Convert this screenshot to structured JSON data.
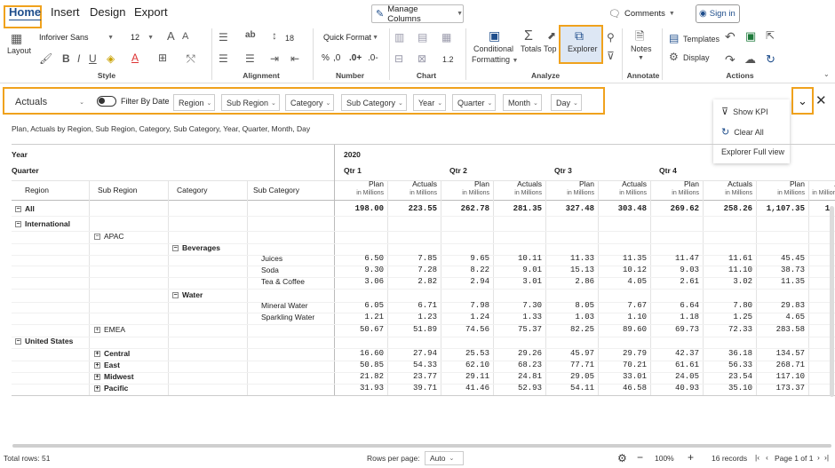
{
  "ribbon": {
    "tabs": [
      "Home",
      "Insert",
      "Design",
      "Export"
    ],
    "manage_columns": "Manage Columns",
    "comments": "Comments",
    "sign_in": "Sign in",
    "font_name": "Inforiver Sans",
    "font_size": "12",
    "row_height": "18",
    "number_format": "Quick Format",
    "layout_label": "Layout",
    "cond_format_l1": "Conditional",
    "cond_format_l2": "Formatting",
    "totals": "Totals",
    "top_n": "Top n",
    "explorer": "Explorer",
    "notes": "Notes",
    "templates": "Templates",
    "display": "Display",
    "groups": {
      "style": "Style",
      "alignment": "Alignment",
      "number": "Number",
      "chart": "Chart",
      "analyze": "Analyze",
      "annotate": "Annotate",
      "actions": "Actions"
    },
    "decimal_small": "1.2",
    "pct": "%",
    "comma": ",0",
    "dec_plus": ".0+",
    "dec_minus": ".0-"
  },
  "filter_bar": {
    "scenario": "Actuals",
    "filter_by_date": "Filter By Date",
    "chips": [
      "Region",
      "Sub Region",
      "Category",
      "Sub Category",
      "Year",
      "Quarter",
      "Month",
      "Day"
    ]
  },
  "menu": {
    "show_kpi": "Show KPI",
    "clear_all": "Clear All",
    "explorer_full_view": "Explorer Full view"
  },
  "grid": {
    "title": "Plan, Actuals by Region, Sub Region, Category, Sub Category, Year, Quarter, Month, Day",
    "year_label": "Year",
    "quarter_label": "Quarter",
    "year": "2020",
    "quarters": [
      "Qtr 1",
      "Qtr 2",
      "Qtr 3",
      "Qtr 4"
    ],
    "dim_headers": [
      "Region",
      "Sub Region",
      "Category",
      "Sub Category"
    ],
    "measure_names": [
      "Plan",
      "Actuals",
      "Plan",
      "Actuals",
      "Plan",
      "Actuals",
      "Plan",
      "Actuals",
      "Plan",
      "A"
    ],
    "unit": "in Millions",
    "rows": [
      {
        "level": 0,
        "label": "All",
        "box": "−",
        "bold": true,
        "values": [
          "198.00",
          "223.55",
          "262.78",
          "281.35",
          "327.48",
          "303.48",
          "269.62",
          "258.26",
          "1,107.35",
          "1,1"
        ]
      },
      {
        "level": 0,
        "label": "International",
        "box": "−",
        "bold": true,
        "values": []
      },
      {
        "level": 1,
        "label": "APAC",
        "box": "−",
        "bold": false,
        "values": []
      },
      {
        "level": 2,
        "label": "Beverages",
        "box": "−",
        "bold": true,
        "values": []
      },
      {
        "level": 3,
        "label": "Juices",
        "values": [
          "6.50",
          "7.85",
          "9.65",
          "10.11",
          "11.33",
          "11.35",
          "11.47",
          "11.61",
          "45.45",
          ""
        ]
      },
      {
        "level": 3,
        "label": "Soda",
        "values": [
          "9.30",
          "7.28",
          "8.22",
          "9.01",
          "15.13",
          "10.12",
          "9.03",
          "11.10",
          "38.73",
          ""
        ]
      },
      {
        "level": 3,
        "label": "Tea & Coffee",
        "values": [
          "3.06",
          "2.82",
          "2.94",
          "3.01",
          "2.86",
          "4.05",
          "2.61",
          "3.02",
          "11.35",
          ""
        ]
      },
      {
        "level": 2,
        "label": "Water",
        "box": "−",
        "bold": true,
        "values": []
      },
      {
        "level": 3,
        "label": "Mineral Water",
        "values": [
          "6.05",
          "6.71",
          "7.98",
          "7.30",
          "8.05",
          "7.67",
          "6.64",
          "7.80",
          "29.83",
          ""
        ]
      },
      {
        "level": 3,
        "label": "Sparkling Water",
        "values": [
          "1.21",
          "1.23",
          "1.24",
          "1.33",
          "1.03",
          "1.10",
          "1.18",
          "1.25",
          "4.65",
          ""
        ]
      },
      {
        "level": 1,
        "label": "EMEA",
        "box": "+",
        "bold": false,
        "values": [
          "50.67",
          "51.89",
          "74.56",
          "75.37",
          "82.25",
          "89.60",
          "69.73",
          "72.33",
          "283.58",
          ""
        ]
      },
      {
        "level": 0,
        "label": "United States",
        "box": "−",
        "bold": true,
        "values": []
      },
      {
        "level": 1,
        "label": "Central",
        "box": "+",
        "bold": true,
        "values": [
          "16.60",
          "27.94",
          "25.53",
          "29.26",
          "45.97",
          "29.79",
          "42.37",
          "36.18",
          "134.57",
          ""
        ]
      },
      {
        "level": 1,
        "label": "East",
        "box": "+",
        "bold": true,
        "values": [
          "50.85",
          "54.33",
          "62.10",
          "68.23",
          "77.71",
          "70.21",
          "61.61",
          "56.33",
          "268.71",
          ""
        ]
      },
      {
        "level": 1,
        "label": "Midwest",
        "box": "+",
        "bold": true,
        "values": [
          "21.82",
          "23.77",
          "29.11",
          "24.81",
          "29.05",
          "33.01",
          "24.05",
          "23.54",
          "117.10",
          ""
        ]
      },
      {
        "level": 1,
        "label": "Pacific",
        "box": "+",
        "bold": true,
        "values": [
          "31.93",
          "39.71",
          "41.46",
          "52.93",
          "54.11",
          "46.58",
          "40.93",
          "35.10",
          "173.37",
          ""
        ]
      }
    ]
  },
  "footer": {
    "total_rows": "Total rows: 51",
    "rows_per_page_label": "Rows per page:",
    "rows_per_page": "Auto",
    "zoom": "100%",
    "records": "16 records",
    "page": "Page 1 of 1"
  }
}
